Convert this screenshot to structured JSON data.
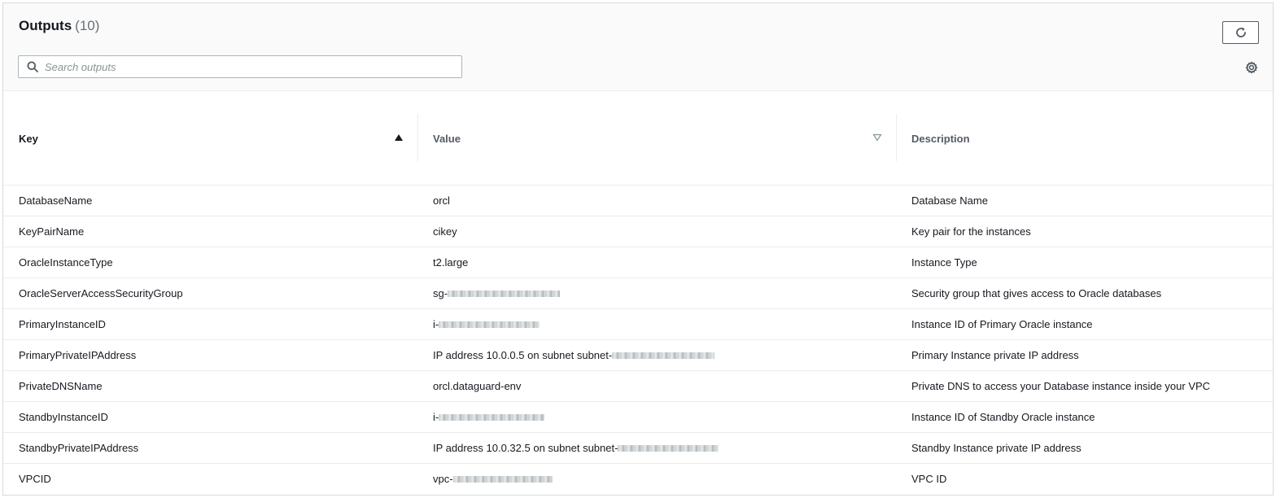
{
  "header": {
    "title": "Outputs",
    "count": "(10)",
    "search_placeholder": "Search outputs"
  },
  "icons": {
    "refresh": "refresh-icon",
    "search": "search-icon",
    "settings": "gear-icon",
    "sort_asc": "caret-up-icon",
    "sort_desc": "caret-down-outline-icon"
  },
  "table": {
    "columns": [
      "Key",
      "Value",
      "Description"
    ],
    "rows": [
      {
        "key": "DatabaseName",
        "value": "orcl",
        "description": "Database Name"
      },
      {
        "key": "KeyPairName",
        "value": "cikey",
        "description": "Key pair for the instances"
      },
      {
        "key": "OracleInstanceType",
        "value": "t2.large",
        "description": "Instance Type"
      },
      {
        "key": "OracleServerAccessSecurityGroup",
        "value": "sg-",
        "description": "Security group that gives access to Oracle databases"
      },
      {
        "key": "PrimaryInstanceID",
        "value": "i-",
        "description": "Instance ID of Primary Oracle instance"
      },
      {
        "key": "PrimaryPrivateIPAddress",
        "value": "IP address 10.0.0.5 on subnet subnet-",
        "description": "Primary Instance private IP address"
      },
      {
        "key": "PrivateDNSName",
        "value": "orcl.dataguard-env",
        "description": "Private DNS to access your Database instance inside your VPC"
      },
      {
        "key": "StandbyInstanceID",
        "value": "i-",
        "description": "Instance ID of Standby Oracle instance"
      },
      {
        "key": "StandbyPrivateIPAddress",
        "value": "IP address 10.0.32.5 on subnet subnet-",
        "description": "Standby Instance private IP address"
      },
      {
        "key": "VPCID",
        "value": "vpc-",
        "description": "VPC ID"
      }
    ]
  },
  "colors": {
    "text": "#16191f",
    "muted": "#687078",
    "border": "#eaeded",
    "header_bg": "#fafafa"
  }
}
